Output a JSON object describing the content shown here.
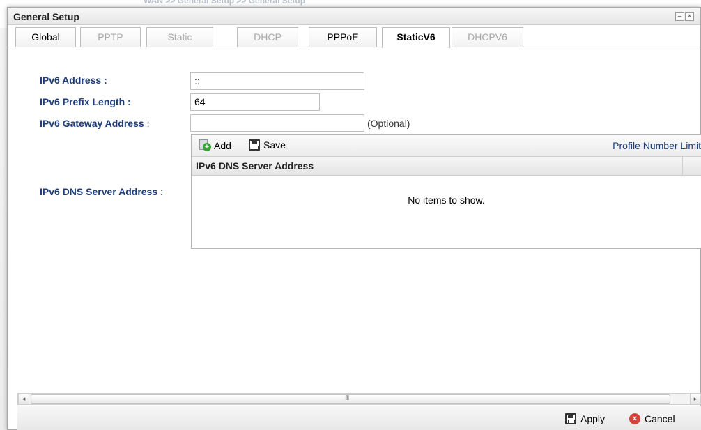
{
  "background": {
    "breadcrumb": "WAN >> General Setup >> General Setup"
  },
  "window": {
    "title": "General Setup",
    "minimize_glyph": "–",
    "close_glyph": "×"
  },
  "tabs": [
    {
      "label": "Global",
      "state": "enabled"
    },
    {
      "label": "PPTP",
      "state": "disabled"
    },
    {
      "label": "Static",
      "state": "disabled"
    },
    {
      "label": "DHCP",
      "state": "disabled"
    },
    {
      "label": "PPPoE",
      "state": "enabled"
    },
    {
      "label": "StaticV6",
      "state": "active"
    },
    {
      "label": "DHCPV6",
      "state": "disabled"
    }
  ],
  "form": {
    "ipv6_address": {
      "label": "IPv6 Address",
      "colon": ":",
      "value": "::"
    },
    "prefix_length": {
      "label": "IPv6 Prefix Length",
      "colon": ":",
      "value": "64"
    },
    "gateway_address": {
      "label": "IPv6 Gateway Address",
      "colon": ":",
      "value": "",
      "hint": "(Optional)"
    },
    "dns_server_address": {
      "label": "IPv6 DNS Server Address",
      "colon": ":"
    }
  },
  "dns_grid": {
    "add_label": "Add",
    "save_label": "Save",
    "profile_limit_label": "Profile Number Limit",
    "columns": [
      "IPv6 DNS Server Address"
    ],
    "rows": [],
    "empty_text": "No items to show."
  },
  "scrollbar": {
    "left_arrow": "◂",
    "right_arrow": "▸",
    "grip": "III"
  },
  "footer": {
    "apply_label": "Apply",
    "cancel_label": "Cancel"
  },
  "colors": {
    "label_blue": "#1c3d7a",
    "disabled_tab": "#a8a8a8",
    "add_icon_green": "#3aa33a",
    "cancel_icon_red": "#d8433c"
  },
  "icons": {
    "add": "add-icon",
    "save": "save-icon",
    "apply": "save-icon",
    "cancel": "cancel-icon"
  }
}
